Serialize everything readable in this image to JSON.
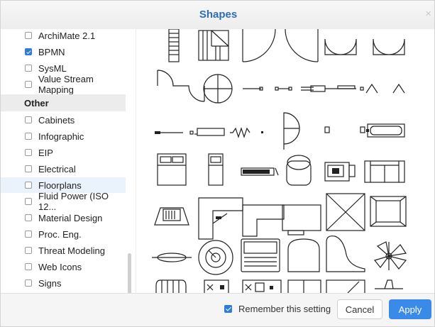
{
  "dialog": {
    "title": "Shapes",
    "close_glyph": "×"
  },
  "sidebar": {
    "items_top": [
      {
        "label": "ArchiMate 2.1",
        "checked": false
      },
      {
        "label": "BPMN",
        "checked": true
      },
      {
        "label": "SysML",
        "checked": false
      },
      {
        "label": "Value Stream Mapping",
        "checked": false
      }
    ],
    "section_title": "Other",
    "items_other": [
      {
        "label": "Cabinets",
        "checked": false
      },
      {
        "label": "Infographic",
        "checked": false
      },
      {
        "label": "EIP",
        "checked": false
      },
      {
        "label": "Electrical",
        "checked": false
      },
      {
        "label": "Floorplans",
        "checked": false,
        "highlighted": true
      },
      {
        "label": "Fluid Power (ISO 12...",
        "checked": false
      },
      {
        "label": "Material Design",
        "checked": false
      },
      {
        "label": "Proc. Eng.",
        "checked": false
      },
      {
        "label": "Threat Modeling",
        "checked": false
      },
      {
        "label": "Web Icons",
        "checked": false
      },
      {
        "label": "Signs",
        "checked": false
      }
    ]
  },
  "preview": {
    "library": "Floorplans shape previews"
  },
  "footer": {
    "remember_label": "Remember this setting",
    "remember_checked": true,
    "cancel_label": "Cancel",
    "apply_label": "Apply"
  },
  "colors": {
    "accent": "#3a8aea",
    "title": "#2f6db3",
    "highlight": "#eaf2fb"
  }
}
